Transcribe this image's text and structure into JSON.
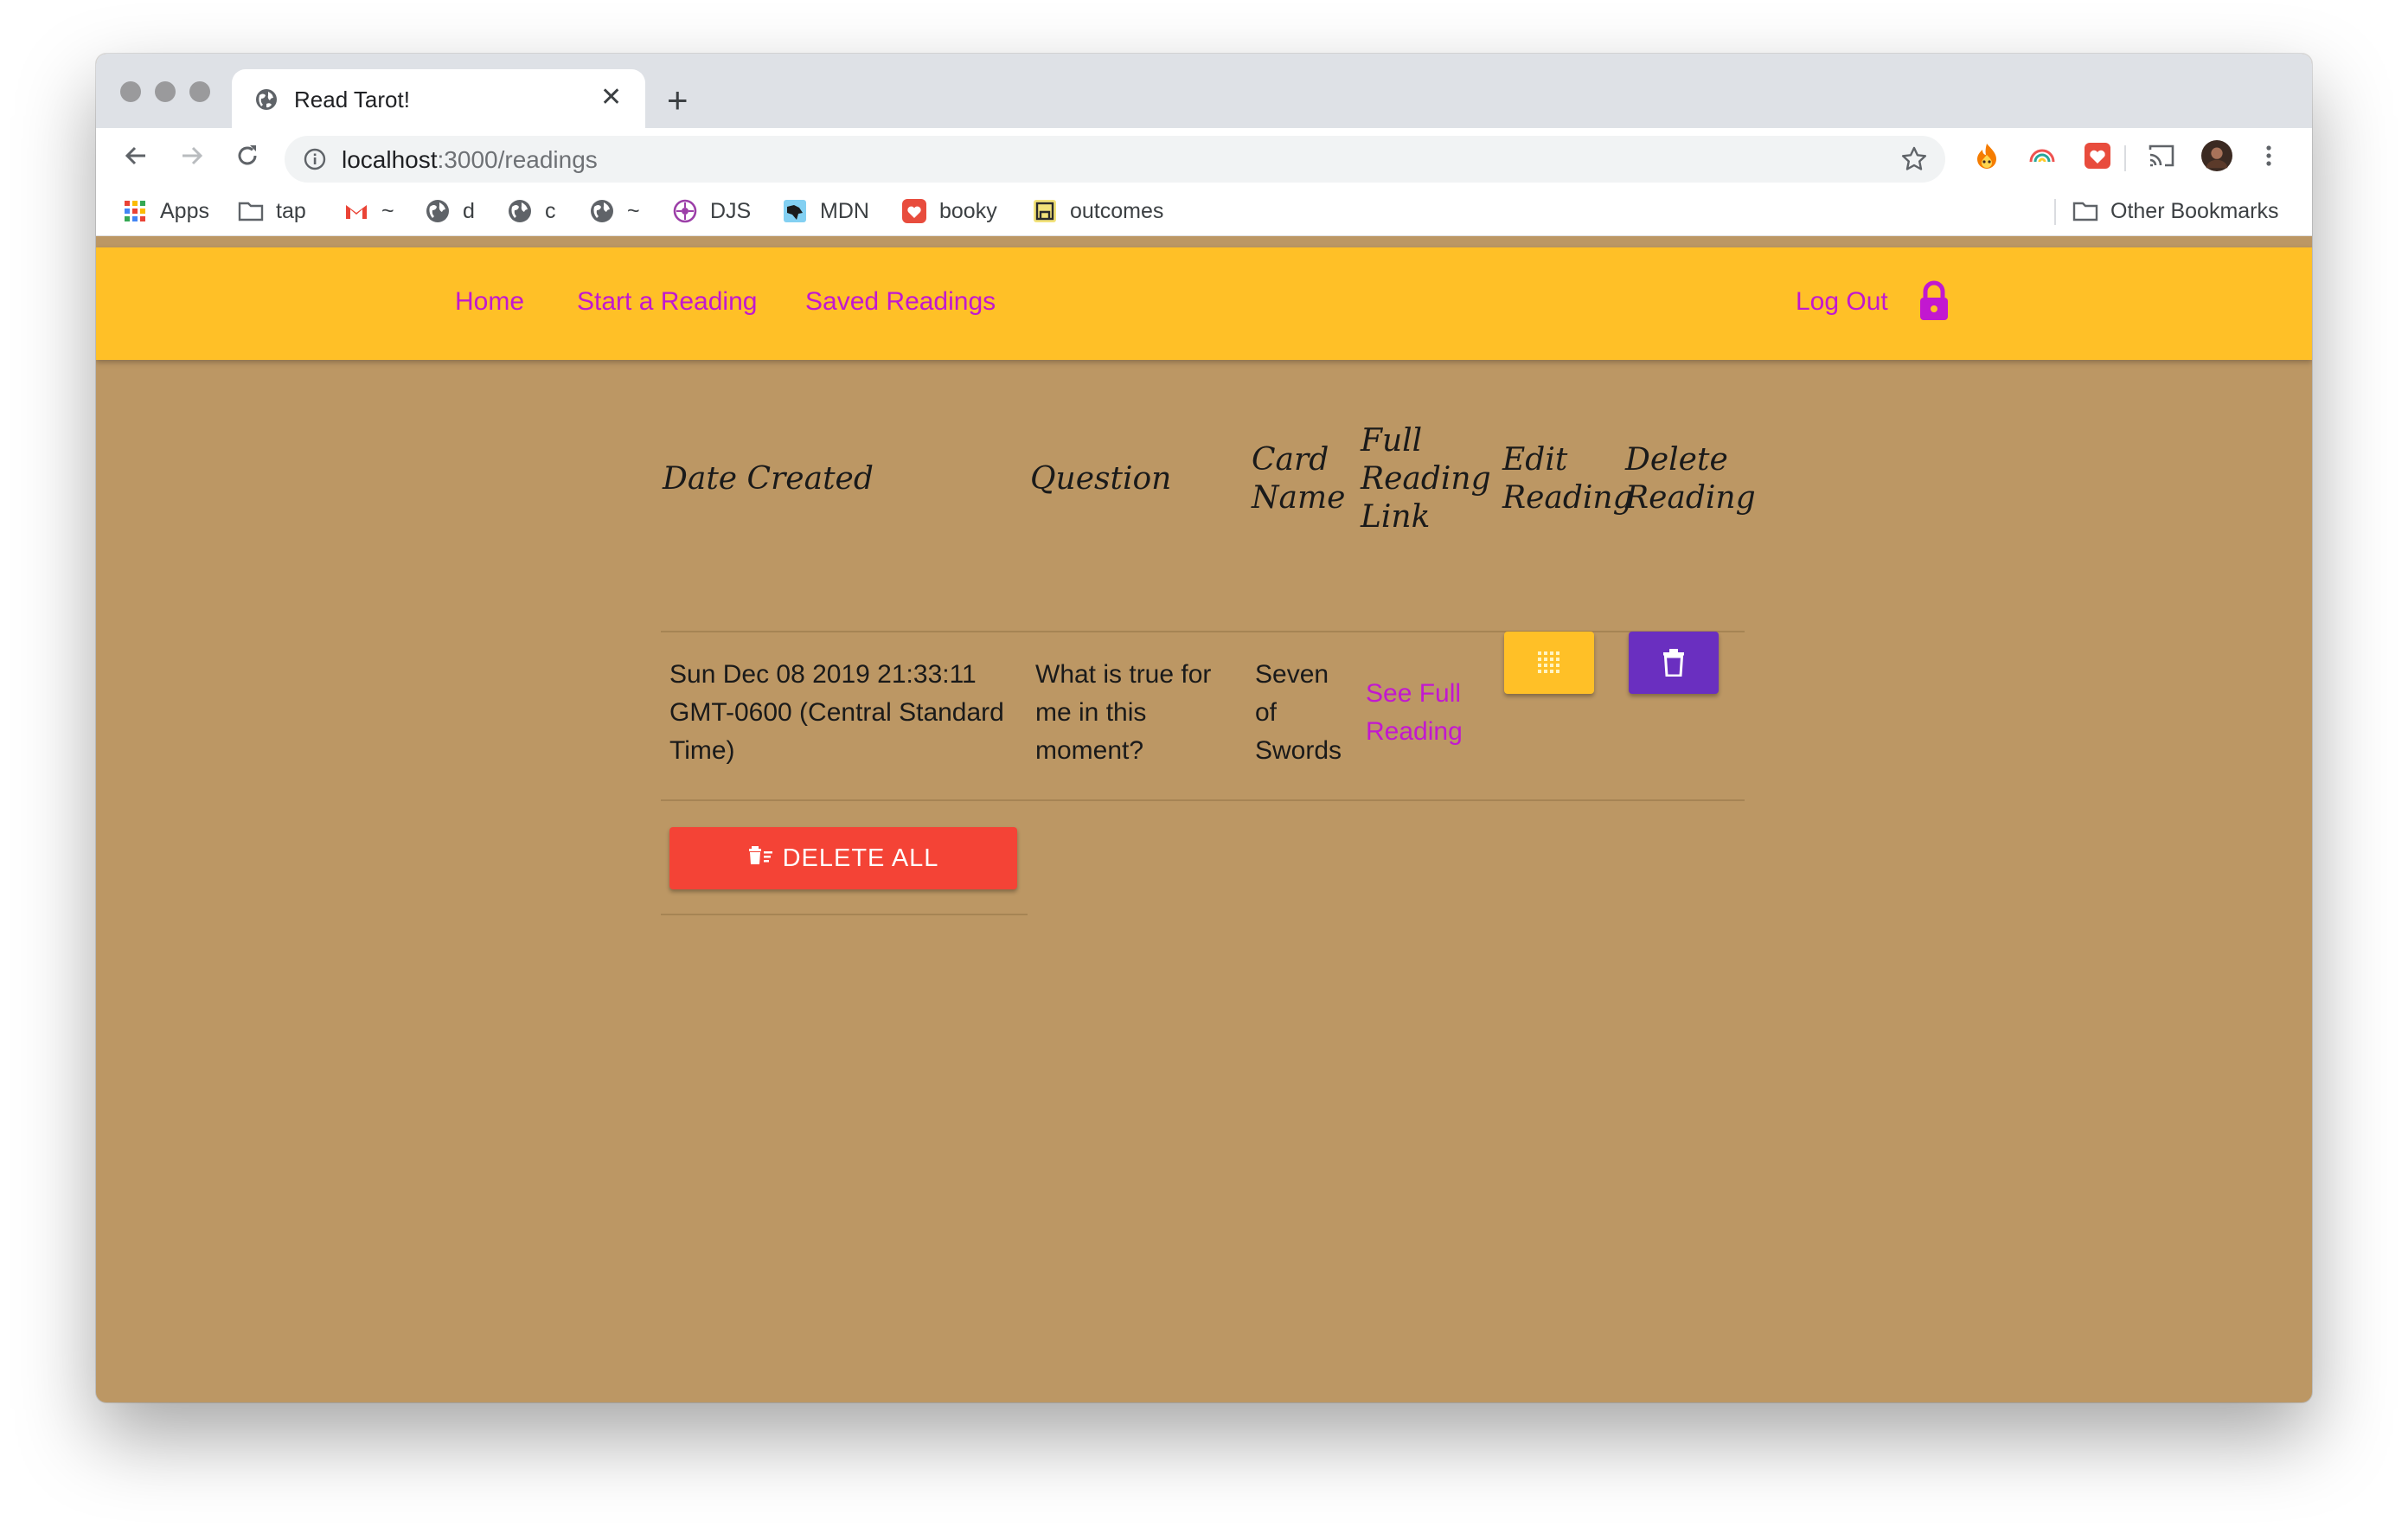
{
  "browser": {
    "tab_title": "Read Tarot!",
    "url_host": "localhost",
    "url_rest": ":3000/readings",
    "icons": [
      "back-icon",
      "forward-icon",
      "reload-icon",
      "info-icon",
      "star-icon",
      "new-tab-icon",
      "close-icon",
      "cast-icon",
      "menu-icon"
    ]
  },
  "bookmarks": [
    {
      "label": "Apps",
      "icon": "apps-grid-icon"
    },
    {
      "label": "tap",
      "icon": "folder-icon"
    },
    {
      "label": "~",
      "icon": "gmail-icon"
    },
    {
      "label": "d",
      "icon": "globe-icon"
    },
    {
      "label": "c",
      "icon": "globe-icon"
    },
    {
      "label": "~",
      "icon": "globe-icon"
    },
    {
      "label": "DJS",
      "icon": "djs-icon"
    },
    {
      "label": "MDN",
      "icon": "mdn-icon"
    },
    {
      "label": "booky",
      "icon": "heart-icon"
    },
    {
      "label": "outcomes",
      "icon": "outcomes-icon"
    }
  ],
  "other_bookmarks": "Other Bookmarks",
  "nav": {
    "home": "Home",
    "start": "Start a Reading",
    "saved": "Saved Readings",
    "logout": "Log Out"
  },
  "table": {
    "headers": {
      "date": "Date Created",
      "question": "Question",
      "card_1": "Card",
      "card_2": "Name",
      "full_1": "Full",
      "full_2": "Reading",
      "full_3": "Link",
      "edit_1": "Edit",
      "edit_2": "Reading",
      "delete_1": "Delete",
      "delete_2": "Reading"
    },
    "row": {
      "date_1": "Sun Dec 08 2019 21:33:11",
      "date_2": "GMT-0600 (Central Standard",
      "date_3": "Time)",
      "question_1": "What is true for",
      "question_2": "me in this",
      "question_3": "moment?",
      "card_1": "Seven",
      "card_2": "of",
      "card_3": "Swords",
      "link_1": "See Full",
      "link_2": "Reading"
    },
    "delete_all": "DELETE ALL"
  },
  "colors": {
    "nav_bg": "#ffc027",
    "page_bg": "#bc9764",
    "link": "#c218d0",
    "edit_button": "#ffc027",
    "delete_button": "#6a2fc0",
    "delete_all_button": "#f44336"
  }
}
